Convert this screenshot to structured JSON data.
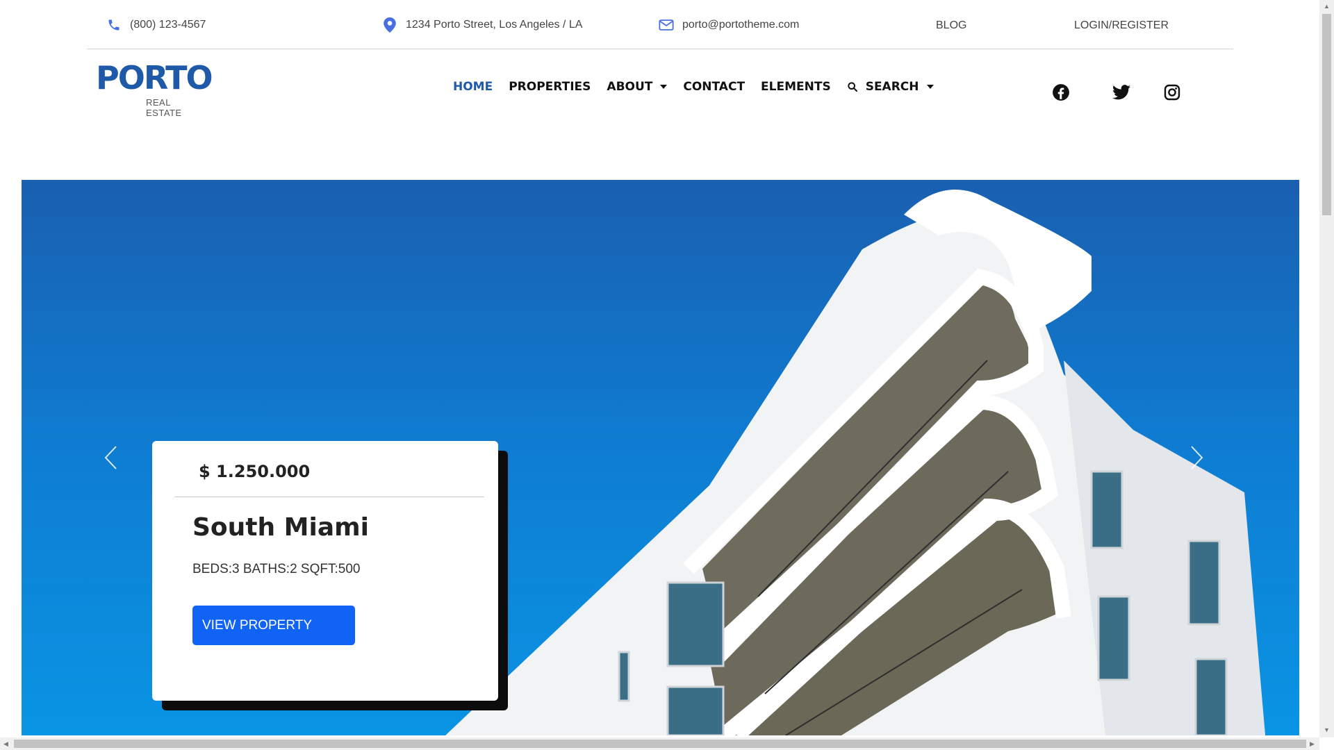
{
  "colors": {
    "brand": "#1e5aa8",
    "button": "#1163f5",
    "hero_sky": "#0f7bd0"
  },
  "topbar": {
    "phone": {
      "icon": "phone-icon",
      "text": "(800) 123-4567"
    },
    "address": {
      "icon": "map-pin-icon",
      "text": "1234 Porto Street, Los Angeles / LA"
    },
    "email": {
      "icon": "envelope-icon",
      "text": "porto@portotheme.com"
    },
    "blog": "BLOG",
    "login": "LOGIN/REGISTER"
  },
  "logo": {
    "main": "PORTO",
    "sub": "REAL ESTATE"
  },
  "nav": {
    "home": "HOME",
    "properties": "PROPERTIES",
    "about": "ABOUT",
    "contact": "CONTACT",
    "elements": "ELEMENTS",
    "search": "SEARCH"
  },
  "social": [
    "facebook-icon",
    "twitter-icon",
    "instagram-icon"
  ],
  "hero": {
    "price": "$ 1.250.000",
    "title": "South Miami",
    "specs": "BEDS:3 BATHS:2 SQFT:500",
    "button": "VIEW PROPERTY"
  }
}
